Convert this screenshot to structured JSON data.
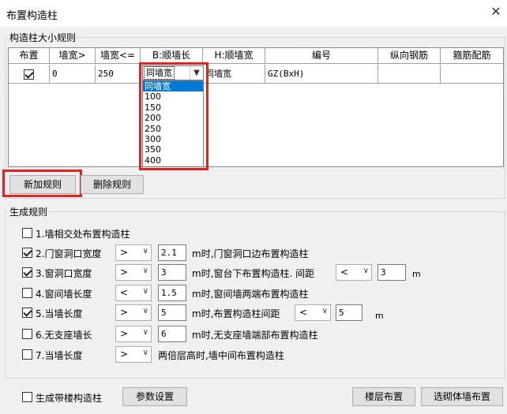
{
  "window": {
    "title": "布置构造柱",
    "close_glyph": "✕"
  },
  "size_rules": {
    "group_label": "构造柱大小规则",
    "columns": [
      "布置",
      "墙宽>",
      "墙宽<=",
      "B:顺墙长",
      "H:顺墙宽",
      "编号",
      "纵向钢筋",
      "箍筋配筋"
    ],
    "row": {
      "checked": true,
      "min_width": "0",
      "max_width": "250",
      "b_value": "同墙宽",
      "h_value": "同墙宽",
      "code": "GZ(BxH)",
      "rebar": "",
      "stirrup": ""
    },
    "dropdown_options": [
      "同墙宽",
      "100",
      "150",
      "200",
      "250",
      "300",
      "350",
      "400"
    ],
    "dropdown_selected": "同墙宽",
    "add_button": "新加规则",
    "delete_button": "删除规则"
  },
  "gen_rules": {
    "group_label": "生成规则",
    "r1": {
      "checked": false,
      "label": "1.墙相交处布置构造柱"
    },
    "r2": {
      "checked": true,
      "label": "2.门窗洞口宽度",
      "op": ">",
      "value": "2.1",
      "suffix": "m时,门窗洞口边布置构造柱"
    },
    "r3": {
      "checked": true,
      "label": "3.窗洞口宽度",
      "op": ">",
      "value": "3",
      "suffix": "m时,窗台下布置构造柱. 间距",
      "op2": "<",
      "value2": "3",
      "unit": "m"
    },
    "r4": {
      "checked": false,
      "label": "4.窗间墙长度",
      "op": "<",
      "value": "1.5",
      "suffix": "m时,窗间墙两端布置构造柱"
    },
    "r5": {
      "checked": true,
      "label": "5.当墙长度",
      "op": ">",
      "value": "5",
      "suffix": "m时,布置构造柱间距",
      "op2": "<",
      "value2": "5",
      "unit": "m"
    },
    "r6": {
      "checked": false,
      "label": "6.无支座墙长",
      "op": ">",
      "value": "6",
      "suffix": "m时,无支座墙端部布置构造柱"
    },
    "r7": {
      "checked": false,
      "label": "7.当墙长度",
      "op": ">",
      "suffix": "两倍层高时,墙中间布置构造柱"
    }
  },
  "footer": {
    "gen_stair_checked": false,
    "gen_stair_label": "生成带楼构造柱",
    "param_button": "参数设置",
    "floor_button": "楼层布置",
    "select_wall_button": "选砌体墙布置"
  },
  "colors": {
    "highlight": "#e02424",
    "selection": "#0078d7"
  }
}
